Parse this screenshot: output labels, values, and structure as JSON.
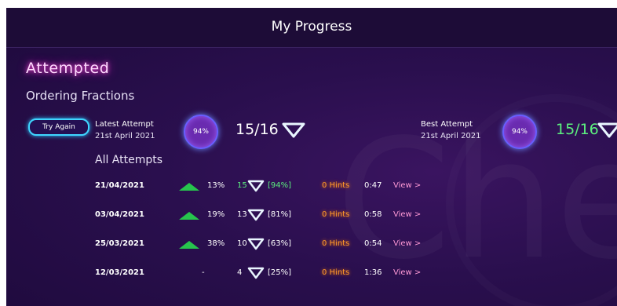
{
  "header": {
    "title": "My Progress"
  },
  "section": {
    "heading": "Attempted",
    "topic": "Ordering Fractions"
  },
  "actions": {
    "try_again_label": "Try Again"
  },
  "latest": {
    "label": "Latest Attempt",
    "date": "21st April 2021",
    "percent": "94%",
    "score": "15/16"
  },
  "best": {
    "label": "Best Attempt",
    "date": "21st April 2021",
    "percent": "94%",
    "score": "15/16"
  },
  "all_attempts": {
    "heading": "All Attempts",
    "rows": [
      {
        "date": "21/04/2021",
        "trend": "up",
        "change": "13%",
        "score": "15",
        "bracket": "[94%]",
        "hints": "0 Hints",
        "time": "0:47",
        "view": "View >"
      },
      {
        "date": "03/04/2021",
        "trend": "up",
        "change": "19%",
        "score": "13",
        "bracket": "[81%]",
        "hints": "0 Hints",
        "time": "0:58",
        "view": "View >"
      },
      {
        "date": "25/03/2021",
        "trend": "up",
        "change": "38%",
        "score": "10",
        "bracket": "[63%]",
        "hints": "0 Hints",
        "time": "0:54",
        "view": "View >"
      },
      {
        "date": "12/03/2021",
        "trend": "-",
        "change": "",
        "score": "4",
        "bracket": "[25%]",
        "hints": "0 Hints",
        "time": "1:36",
        "view": "View >"
      }
    ]
  },
  "watermark": "Che",
  "colors": {
    "background": "#2a0f4e",
    "accent_green": "#5cf07f",
    "accent_cyan": "#3fd6ff",
    "hint_orange": "#ff9a2a",
    "view_pink": "#ff9ad6"
  },
  "icons": {
    "score_gem": "diamond-outline-icon",
    "trend_up": "triangle-up-icon"
  }
}
